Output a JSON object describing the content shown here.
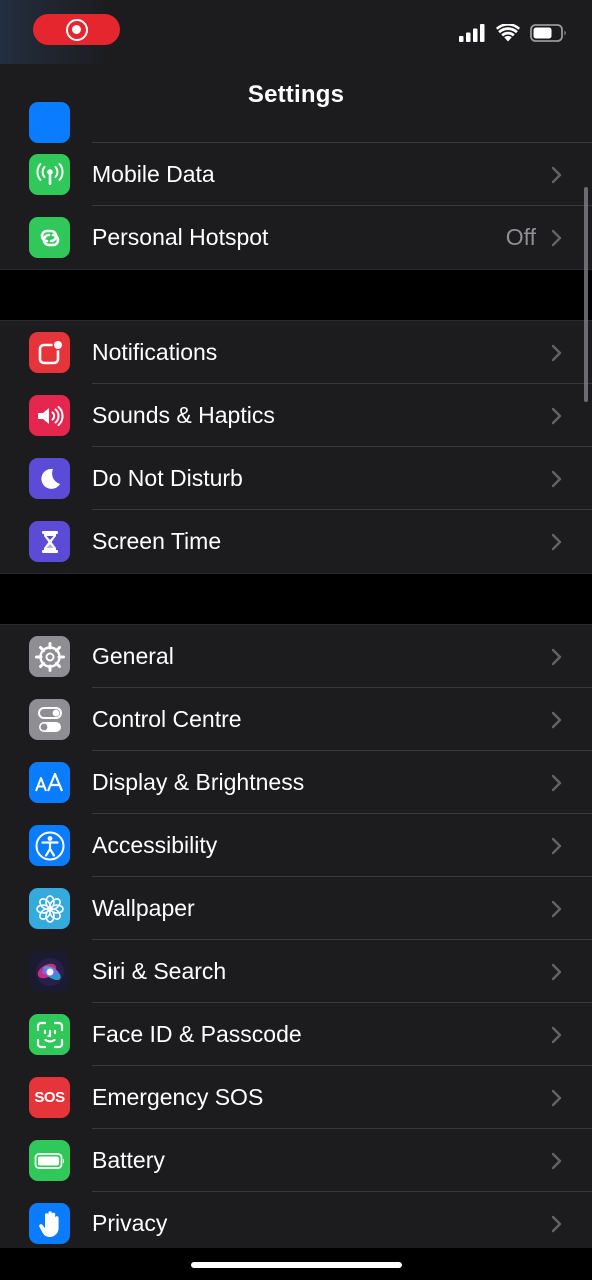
{
  "status_bar": {
    "recording_indicator": "screen-recording",
    "icons": [
      "cellular-signal-icon",
      "wifi-icon",
      "battery-icon"
    ]
  },
  "header": {
    "title": "Settings"
  },
  "groups": [
    {
      "rows": [
        {
          "label": "Mobile Data",
          "value": "",
          "icon": "antenna-icon",
          "color": "#30c85a"
        },
        {
          "label": "Personal Hotspot",
          "value": "Off",
          "icon": "hotspot-link-icon",
          "color": "#30c85a"
        }
      ]
    },
    {
      "rows": [
        {
          "label": "Notifications",
          "value": "",
          "icon": "notification-badge-icon",
          "color": "#e5343a"
        },
        {
          "label": "Sounds & Haptics",
          "value": "",
          "icon": "speaker-icon",
          "color": "#e5264f"
        },
        {
          "label": "Do Not Disturb",
          "value": "",
          "icon": "moon-icon",
          "color": "#5b4bd6"
        },
        {
          "label": "Screen Time",
          "value": "",
          "icon": "hourglass-icon",
          "color": "#5b4bd6"
        }
      ]
    },
    {
      "rows": [
        {
          "label": "General",
          "value": "",
          "icon": "gear-icon",
          "color": "#8e8e93"
        },
        {
          "label": "Control Centre",
          "value": "",
          "icon": "toggles-icon",
          "color": "#8e8e93"
        },
        {
          "label": "Display & Brightness",
          "value": "",
          "icon": "text-size-icon",
          "color": "#0a7cff"
        },
        {
          "label": "Accessibility",
          "value": "",
          "icon": "accessibility-icon",
          "color": "#0a7cff"
        },
        {
          "label": "Wallpaper",
          "value": "",
          "icon": "flower-icon",
          "color": "#35aadc"
        },
        {
          "label": "Siri & Search",
          "value": "",
          "icon": "siri-icon",
          "color": "#1b1b2f"
        },
        {
          "label": "Face ID & Passcode",
          "value": "",
          "icon": "face-id-icon",
          "color": "#30c85a"
        },
        {
          "label": "Emergency SOS",
          "value": "",
          "icon": "sos-icon",
          "color": "#e5343a",
          "icon_text": "SOS"
        },
        {
          "label": "Battery",
          "value": "",
          "icon": "battery-level-icon",
          "color": "#30c85a"
        },
        {
          "label": "Privacy",
          "value": "",
          "icon": "hand-icon",
          "color": "#0a7cff"
        }
      ]
    }
  ]
}
